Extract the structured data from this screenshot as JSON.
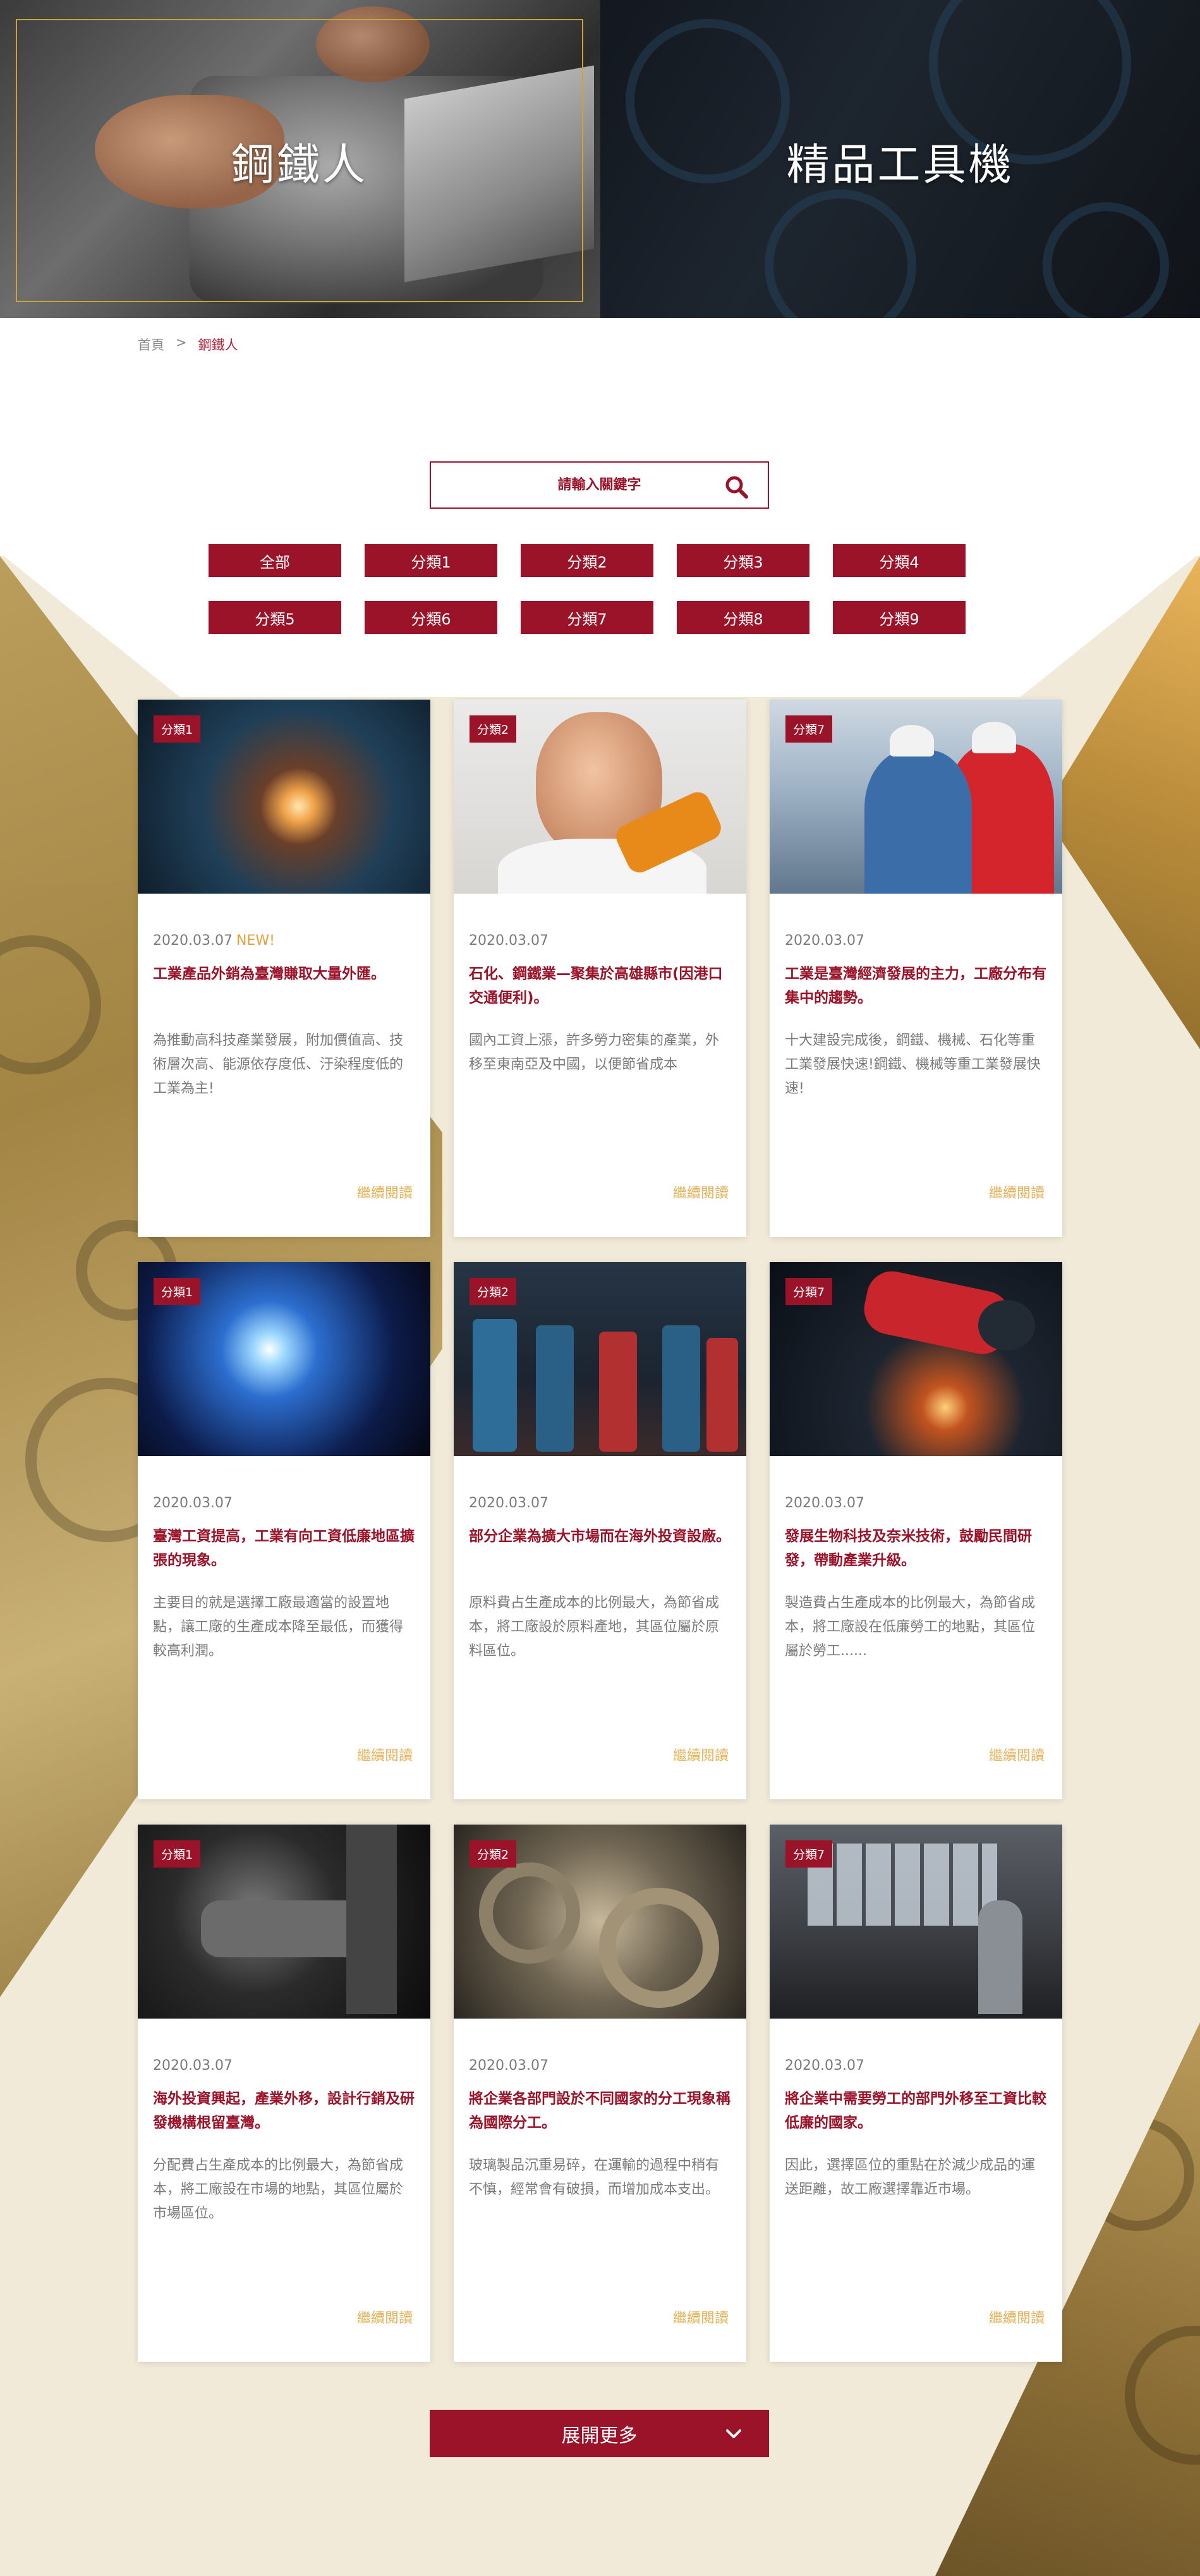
{
  "hero": {
    "left_title": "鋼鐵人",
    "right_title": "精品工具機"
  },
  "breadcrumb": {
    "home": "首頁",
    "separator": ">",
    "current": "鋼鐵人"
  },
  "search": {
    "placeholder": "請輸入關鍵字",
    "icon": "search-icon"
  },
  "categories": [
    "全部",
    "分類1",
    "分類2",
    "分類3",
    "分類4",
    "分類5",
    "分類6",
    "分類7",
    "分類8",
    "分類9"
  ],
  "cards": [
    {
      "tag": "分類1",
      "date": "2020.03.07",
      "new": "NEW!",
      "title": "工業產品外銷為臺灣賺取大量外匯。",
      "desc": "為推動高科技產業發展，附加價值高、技術層次高、能源依存度低、汙染程度低的工業為主!",
      "more": "繼續閱讀"
    },
    {
      "tag": "分類2",
      "date": "2020.03.07",
      "new": "",
      "title": "石化、鋼鐵業—聚集於高雄縣市(因港口交通便利)。",
      "desc": "國內工資上漲，許多勞力密集的產業，外移至東南亞及中國，以便節省成本",
      "more": "繼續閱讀"
    },
    {
      "tag": "分類7",
      "date": "2020.03.07",
      "new": "",
      "title": "工業是臺灣經濟發展的主力，工廠分布有集中的趨勢。",
      "desc": "十大建設完成後，鋼鐵、機械、石化等重工業發展快速!鋼鐵、機械等重工業發展快速!",
      "more": "繼續閱讀"
    },
    {
      "tag": "分類1",
      "date": "2020.03.07",
      "new": "",
      "title": "臺灣工資提高，工業有向工資低廉地區擴張的現象。",
      "desc": "主要目的就是選擇工廠最適當的設置地點，讓工廠的生產成本降至最低，而獲得較高利潤。",
      "more": "繼續閱讀"
    },
    {
      "tag": "分類2",
      "date": "2020.03.07",
      "new": "",
      "title": "部分企業為擴大市場而在海外投資設廠。",
      "desc": "原料費占生產成本的比例最大，為節省成本，將工廠設於原料產地，其區位屬於原料區位。",
      "more": "繼續閱讀"
    },
    {
      "tag": "分類7",
      "date": "2020.03.07",
      "new": "",
      "title": "發展生物科技及奈米技術，鼓勵民間研發，帶動產業升級。",
      "desc": "製造費占生產成本的比例最大，為節省成本，將工廠設在低廉勞工的地點，其區位屬於勞工......",
      "more": "繼續閱讀"
    },
    {
      "tag": "分類1",
      "date": "2020.03.07",
      "new": "",
      "title": "海外投資興起，產業外移，設計行銷及研發機構根留臺灣。",
      "desc": "分配費占生產成本的比例最大，為節省成本，將工廠設在市場的地點，其區位屬於市場區位。",
      "more": "繼續閱讀"
    },
    {
      "tag": "分類2",
      "date": "2020.03.07",
      "new": "",
      "title": "將企業各部門設於不同國家的分工現象稱為國際分工。",
      "desc": "玻璃製品沉重易碎，在運輸的過程中稍有不慎，經常會有破損，而增加成本支出。",
      "more": "繼續閱讀"
    },
    {
      "tag": "分類7",
      "date": "2020.03.07",
      "new": "",
      "title": "將企業中需要勞工的部門外移至工資比較低廉的國家。",
      "desc": "因此，選擇區位的重點在於減少成品的運送距離，故工廠選擇靠近市場。",
      "more": "繼續閱讀"
    }
  ],
  "load_more": {
    "label": "展開更多",
    "icon": "chevron-down-icon"
  },
  "colors": {
    "brand": "#9b1328",
    "accent_gold": "#e3b25a",
    "new_badge": "#e0a23a",
    "background_cream": "#f2ead8"
  }
}
